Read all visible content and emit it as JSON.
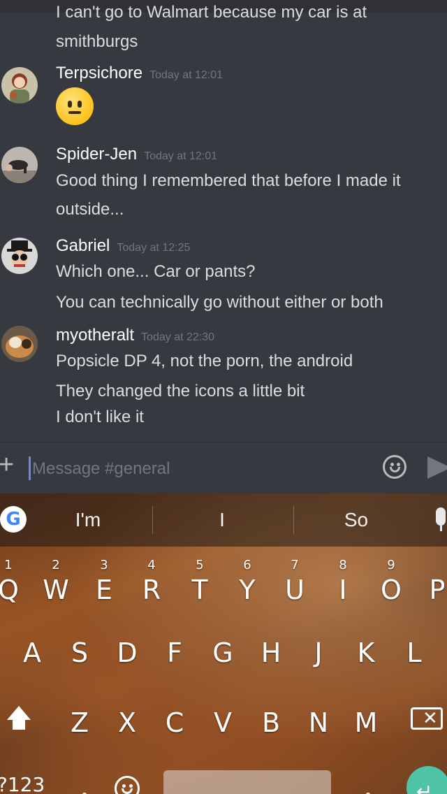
{
  "chat": {
    "partial_message": {
      "lines": [
        "I can't go to Walmart because my car is at",
        "smithburgs"
      ]
    },
    "messages": [
      {
        "author": "Terpsichore",
        "timestamp": "Today at 12:01",
        "lines": [],
        "emoji": "neutral-face"
      },
      {
        "author": "Spider-Jen",
        "timestamp": "Today at 12:01",
        "lines": [
          "Good thing I remembered that before I made it",
          "outside..."
        ]
      },
      {
        "author": "Gabriel",
        "timestamp": "Today at 12:25",
        "lines": [
          "Which one... Car or pants?",
          "You can technically go without either or both"
        ]
      },
      {
        "author": "myotheralt",
        "timestamp": "Today at 22:30",
        "lines": [
          "Popsicle DP 4, not the porn, the android",
          "They changed the icons a little bit",
          "I don't like it"
        ]
      }
    ]
  },
  "input": {
    "placeholder": "Message #general",
    "plus_label": "+"
  },
  "keyboard": {
    "google_label": "G",
    "suggestions": [
      "I'm",
      "I",
      "So"
    ],
    "row1": [
      {
        "label": "Q",
        "hint": "1"
      },
      {
        "label": "W",
        "hint": "2"
      },
      {
        "label": "E",
        "hint": "3"
      },
      {
        "label": "R",
        "hint": "4"
      },
      {
        "label": "T",
        "hint": "5"
      },
      {
        "label": "Y",
        "hint": "6"
      },
      {
        "label": "U",
        "hint": "7"
      },
      {
        "label": "I",
        "hint": "8"
      },
      {
        "label": "O",
        "hint": "9"
      },
      {
        "label": "P",
        "hint": ""
      }
    ],
    "row2": [
      "A",
      "S",
      "D",
      "F",
      "G",
      "H",
      "J",
      "K",
      "L"
    ],
    "row3": [
      "Z",
      "X",
      "C",
      "V",
      "B",
      "N",
      "M"
    ],
    "symbols_label": "?123",
    "enter_glyph": "↵",
    "backspace_glyph": "✕"
  },
  "colors": {
    "background": "#36393f",
    "accent": "#7289da",
    "enter": "#4fc3a7"
  }
}
